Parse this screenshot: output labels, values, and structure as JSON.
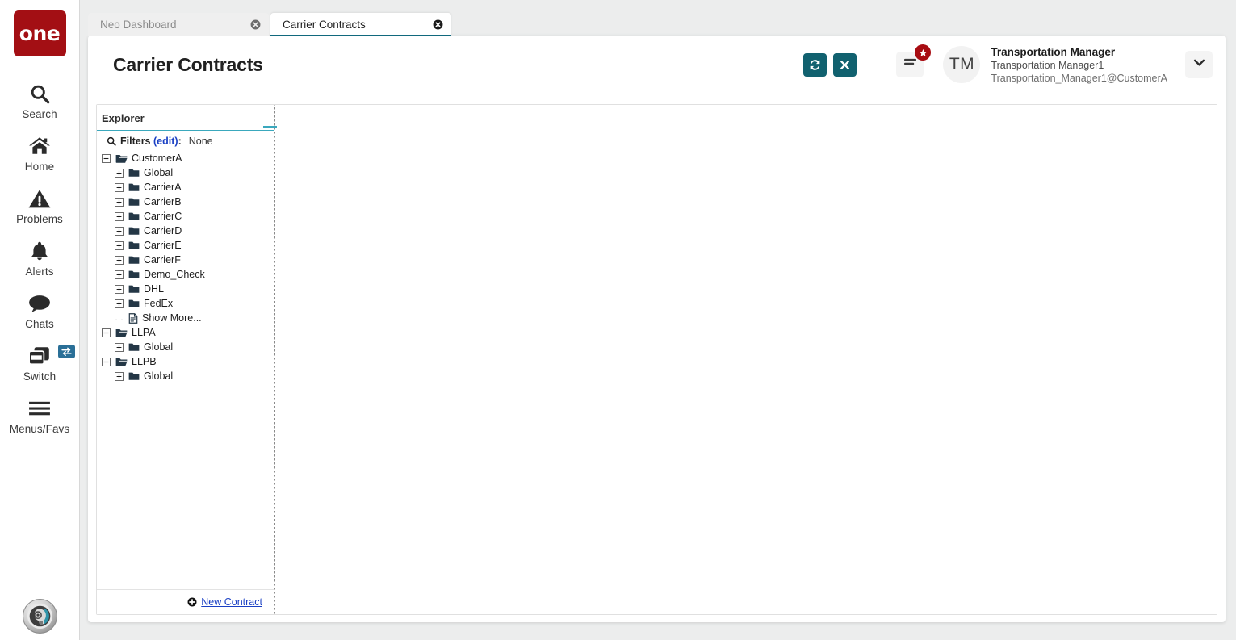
{
  "rail": {
    "logo_text": "one",
    "items": [
      {
        "label": "Search",
        "icon": "search-icon"
      },
      {
        "label": "Home",
        "icon": "home-icon"
      },
      {
        "label": "Problems",
        "icon": "warning-triangle-icon"
      },
      {
        "label": "Alerts",
        "icon": "bell-icon"
      },
      {
        "label": "Chats",
        "icon": "chat-bubble-icon"
      },
      {
        "label": "Switch",
        "icon": "switch-windows-icon",
        "badge": "exchange-arrows-icon"
      },
      {
        "label": "Menus/Favs",
        "icon": "hamburger-icon"
      }
    ],
    "avatar_icon": "ai-assistant-avatar-icon"
  },
  "tabs": [
    {
      "label": "Neo Dashboard",
      "active": false
    },
    {
      "label": "Carrier Contracts",
      "active": true
    }
  ],
  "header": {
    "title": "Carrier Contracts",
    "refresh_label": "refresh-icon",
    "close_label": "close-icon",
    "menu_icon": "hamburger-menu-icon",
    "badge_icon": "star-icon",
    "caret_icon": "chevron-down-icon",
    "user": {
      "initials": "TM",
      "role": "Transportation Manager",
      "name": "Transportation Manager1",
      "email": "Transportation_Manager1@CustomerA"
    }
  },
  "explorer": {
    "title": "Explorer",
    "filters": {
      "icon": "search-icon",
      "label": "Filters",
      "edit_label": "(edit)",
      "colon": ":",
      "value": "None"
    },
    "tree": [
      {
        "label": "CustomerA",
        "level": 0,
        "toggle": "minus",
        "icon": "folder-open-icon"
      },
      {
        "label": "Global",
        "level": 1,
        "toggle": "plus",
        "icon": "folder-icon"
      },
      {
        "label": "CarrierA",
        "level": 1,
        "toggle": "plus",
        "icon": "folder-icon"
      },
      {
        "label": "CarrierB",
        "level": 1,
        "toggle": "plus",
        "icon": "folder-icon"
      },
      {
        "label": "CarrierC",
        "level": 1,
        "toggle": "plus",
        "icon": "folder-icon"
      },
      {
        "label": "CarrierD",
        "level": 1,
        "toggle": "plus",
        "icon": "folder-icon"
      },
      {
        "label": "CarrierE",
        "level": 1,
        "toggle": "plus",
        "icon": "folder-icon"
      },
      {
        "label": "CarrierF",
        "level": 1,
        "toggle": "plus",
        "icon": "folder-icon"
      },
      {
        "label": "Demo_Check",
        "level": 1,
        "toggle": "plus",
        "icon": "folder-icon"
      },
      {
        "label": "DHL",
        "level": 1,
        "toggle": "plus",
        "icon": "folder-icon"
      },
      {
        "label": "FedEx",
        "level": 1,
        "toggle": "plus",
        "icon": "folder-icon"
      },
      {
        "label": "Show More...",
        "level": 1,
        "toggle": "none",
        "icon": "document-icon"
      },
      {
        "label": "LLPA",
        "level": 0,
        "toggle": "minus",
        "icon": "folder-open-icon"
      },
      {
        "label": "Global",
        "level": 1,
        "toggle": "plus",
        "icon": "folder-icon"
      },
      {
        "label": "LLPB",
        "level": 0,
        "toggle": "minus",
        "icon": "folder-open-icon"
      },
      {
        "label": "Global",
        "level": 1,
        "toggle": "plus",
        "icon": "folder-icon"
      }
    ],
    "footer": {
      "new_contract_label": "New Contract",
      "new_contract_icon": "plus-circle-icon"
    }
  },
  "colors": {
    "brand_red": "#a30f14",
    "teal_button": "#11616f",
    "teal_accent": "#3aa8bd",
    "active_tab_underline": "#11697d",
    "link_blue": "#1a3fc4",
    "badge_red": "#a80c12",
    "switch_badge_blue": "#2a6f97",
    "page_background": "#eceded"
  }
}
